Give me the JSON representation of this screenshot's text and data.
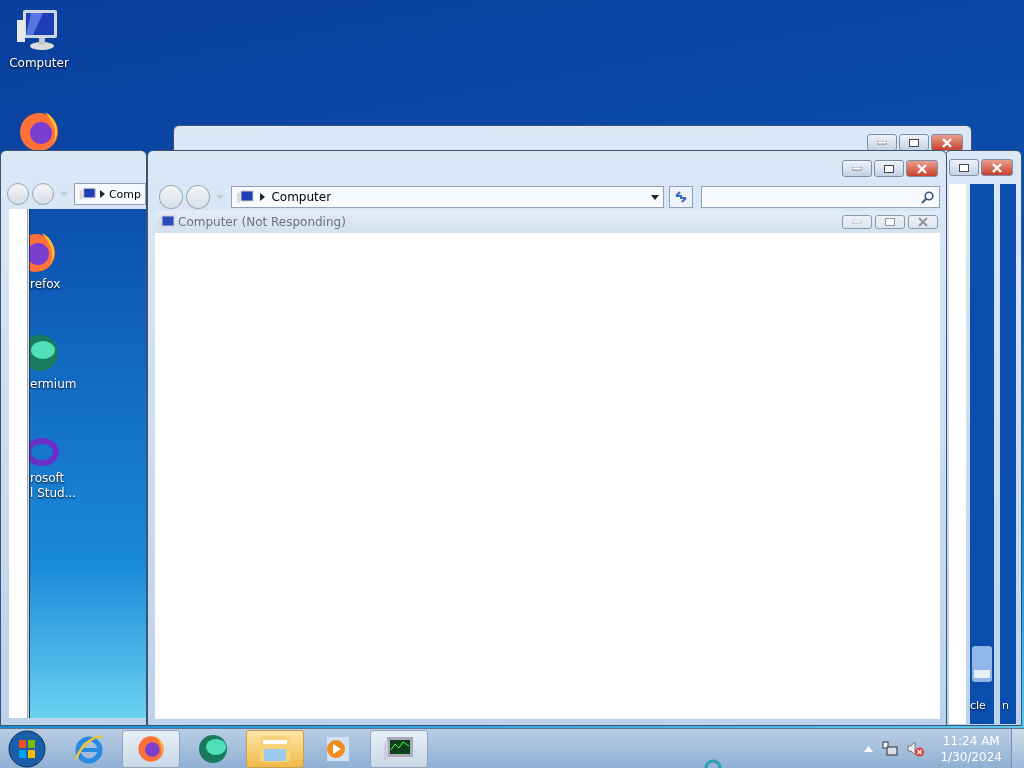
{
  "desktop_icons": [
    {
      "kind": "computer",
      "label": "Computer"
    },
    {
      "kind": "firefox"
    }
  ],
  "left_window": {
    "address": "Comp",
    "ghost_icons": [
      {
        "kind": "firefox",
        "label": "refox"
      },
      {
        "kind": "globe",
        "label": "ermium"
      },
      {
        "kind": "swirl",
        "label": "rosoft\nl Stud..."
      }
    ]
  },
  "right_window": {
    "ghost_icon": {
      "kind": "recycle",
      "labels": [
        "cle",
        "n"
      ]
    }
  },
  "main_window": {
    "address": "Computer",
    "ghost_title": "Computer (Not Responding)"
  },
  "taskbar": {
    "items": [
      {
        "kind": "ie",
        "open": false,
        "selected": false
      },
      {
        "kind": "firefox",
        "open": true,
        "selected": false
      },
      {
        "kind": "globe",
        "open": false,
        "selected": false
      },
      {
        "kind": "folder",
        "open": true,
        "selected": true
      },
      {
        "kind": "media",
        "open": false,
        "selected": false
      },
      {
        "kind": "monitor",
        "open": true,
        "selected": false
      }
    ],
    "time": "11:24 AM",
    "date": "1/30/2024"
  }
}
